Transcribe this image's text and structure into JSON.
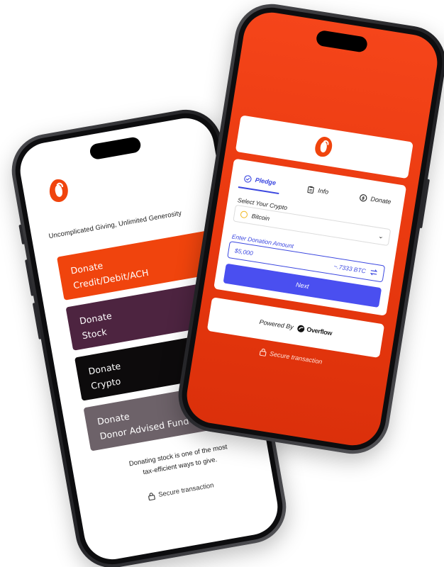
{
  "colors": {
    "brand_orange": "#f0440d",
    "stock_purple": "#4d2440",
    "crypto_black": "#0d0b0c",
    "daf_gray": "#6d6269",
    "accent_blue": "#3b47e0"
  },
  "left_phone": {
    "tagline": "Uncomplicated Giving, Unlimited Generosity",
    "options": [
      {
        "line1": "Donate",
        "line2": "Credit/Debit/ACH"
      },
      {
        "line1": "Donate",
        "line2": "Stock"
      },
      {
        "line1": "Donate",
        "line2": "Crypto"
      },
      {
        "line1": "Donate",
        "line2": "Donor Advised Fund"
      }
    ],
    "info_line1": "Donating stock is one of the most",
    "info_line2": "tax-efficient ways to give.",
    "secure": "Secure transaction",
    "icons": {
      "logo": "brand-logo-icon",
      "lock": "lock-icon"
    }
  },
  "right_phone": {
    "tabs": [
      {
        "label": "Pledge",
        "icon": "check-circle-icon",
        "active": true
      },
      {
        "label": "Info",
        "icon": "clipboard-icon",
        "active": false
      },
      {
        "label": "Donate",
        "icon": "dollar-circle-icon",
        "active": false
      }
    ],
    "select_label": "Select Your Crypto",
    "crypto_value": "Bitcoin",
    "amount_label": "Enter Donation Amount",
    "amount_value": "$5,000",
    "btc_value": "~.7333 BTC",
    "next_label": "Next",
    "powered_by": "Powered By",
    "powered_brand": "Overflow",
    "secure": "Secure transaction",
    "icons": {
      "coin": "bitcoin-icon",
      "chevron": "chevron-down-icon",
      "swap": "swap-icon",
      "lock": "lock-icon"
    }
  }
}
